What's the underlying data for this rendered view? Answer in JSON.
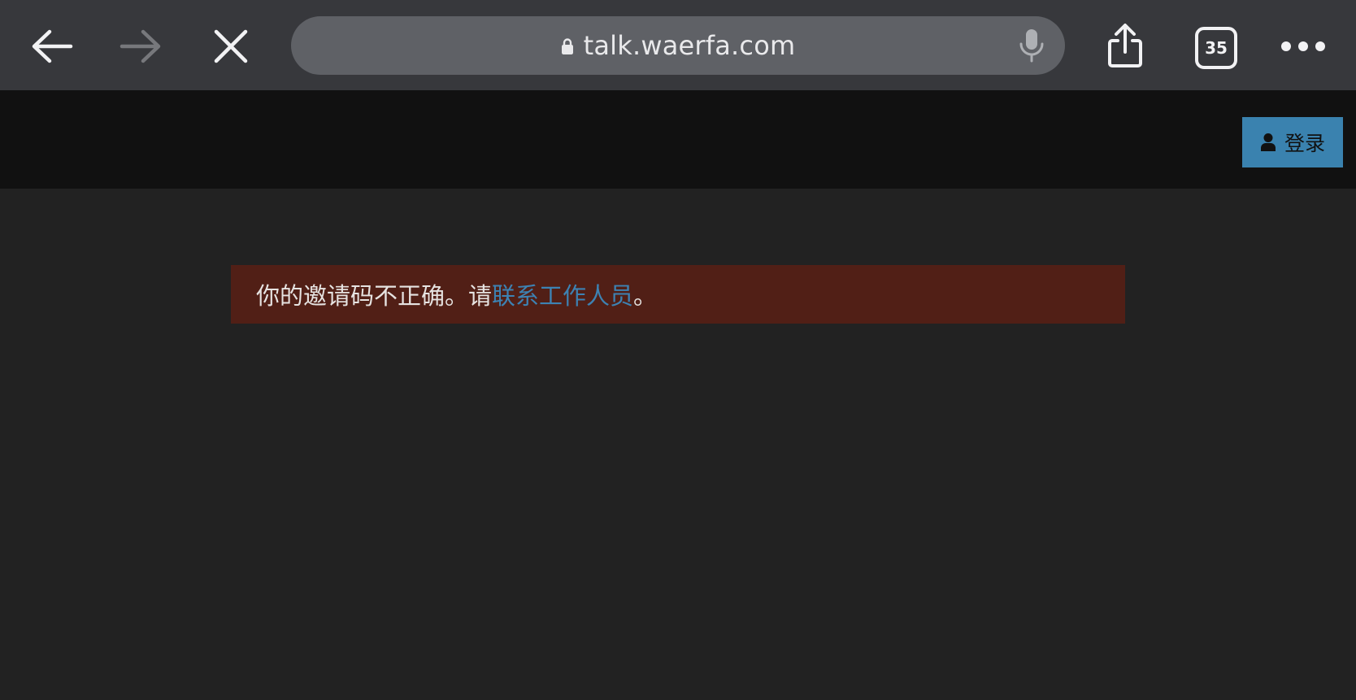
{
  "browser": {
    "url": "talk.waerfa.com",
    "tab_count": "35",
    "colors": {
      "toolbar_bg": "#37383c",
      "url_bar_bg": "#5f6166",
      "icon_active": "#f2f2f4",
      "icon_disabled": "#77787c"
    }
  },
  "header": {
    "login_label": "登录",
    "login_icon": "user-icon",
    "colors": {
      "bg": "#111111",
      "login_bg": "#3a82af"
    }
  },
  "alert": {
    "text_before": "你的邀请码不正确。请",
    "link_text": "联系工作人员",
    "text_after": "。",
    "colors": {
      "bg": "#511f16",
      "text": "#e6e3e1",
      "link": "#3d82b3"
    }
  },
  "page": {
    "colors": {
      "bg": "#222222"
    }
  }
}
